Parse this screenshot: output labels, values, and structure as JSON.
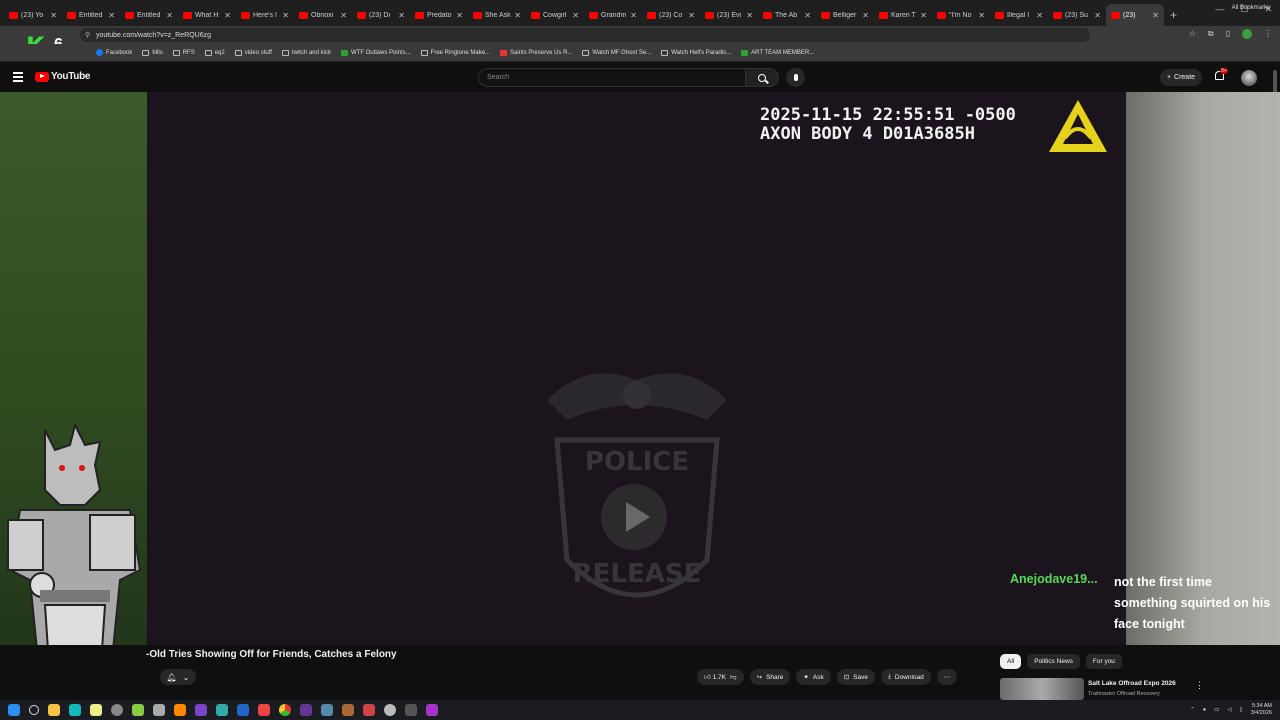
{
  "browser": {
    "tabs": [
      {
        "title": "(23) Yo"
      },
      {
        "title": "Entitled"
      },
      {
        "title": "Entitled"
      },
      {
        "title": "What H"
      },
      {
        "title": "Here's I"
      },
      {
        "title": "Obnoxi"
      },
      {
        "title": "(23) Di"
      },
      {
        "title": "Predato"
      },
      {
        "title": "She Ask"
      },
      {
        "title": "Cowgirl"
      },
      {
        "title": "Grandm"
      },
      {
        "title": "(23) Co"
      },
      {
        "title": "(23) Evi"
      },
      {
        "title": "The Ab"
      },
      {
        "title": "Belliger"
      },
      {
        "title": "Karen T"
      },
      {
        "title": "\"I'm No"
      },
      {
        "title": "Illegal I"
      },
      {
        "title": "(23) Su"
      },
      {
        "title": "(23)",
        "active": true
      }
    ],
    "url": "youtube.com/watch?v=z_ReRQU6zg",
    "bookmarks": [
      {
        "label": "Facebook",
        "icon": "facebook-icon"
      },
      {
        "label": "bills",
        "icon": "folder-icon"
      },
      {
        "label": "RFS",
        "icon": "folder-icon"
      },
      {
        "label": "eq2",
        "icon": "folder-icon"
      },
      {
        "label": "video stuff",
        "icon": "folder-icon"
      },
      {
        "label": "twitch and kick",
        "icon": "folder-icon"
      },
      {
        "label": "WTF Outlaws Points...",
        "icon": "green-app-icon"
      },
      {
        "label": "Free Ringtone Make...",
        "icon": "page-icon"
      },
      {
        "label": "Saints Preserve Us R...",
        "icon": "red-app-icon"
      },
      {
        "label": "Watch MF Ghost Se...",
        "icon": "globe-icon"
      },
      {
        "label": "Watch Hell's Paradis...",
        "icon": "globe-icon"
      },
      {
        "label": "ART TEAM MEMBER...",
        "icon": "green-app-icon"
      }
    ],
    "all_bookmarks": "All Bookmarks"
  },
  "overlay": {
    "k_letter": "K",
    "k_number": "6"
  },
  "youtube": {
    "logo": "YouTube",
    "search_placeholder": "Search",
    "create_label": "Create",
    "notif_badge": "9+"
  },
  "video": {
    "timestamp": "2025-11-15 22:55:51 -0500",
    "device": "AXON BODY 4 D01A3685H",
    "watermark_top": "POLICE",
    "watermark_bottom": "RELEASE",
    "title": "-Old Tries Showing Off for Friends, Catches a Felony"
  },
  "actions": {
    "likes": "1.7K",
    "share": "Share",
    "ask": "Ask",
    "save": "Save",
    "download": "Download"
  },
  "chips": [
    "All",
    "Politics News",
    "For you"
  ],
  "recommendation": {
    "title": "Salt Lake Offroad Expo 2026",
    "channel": "Trailmaster Offroad Recovery"
  },
  "chat": {
    "username": "Anejodave19...",
    "message": "not the first time something squirted on his face tonight"
  },
  "clock": {
    "time": "5:34 AM",
    "date": "3/4/2026"
  }
}
